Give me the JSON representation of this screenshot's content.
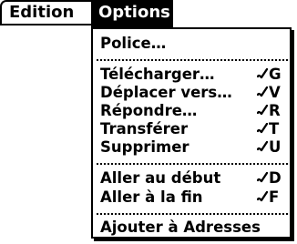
{
  "menubar": {
    "items": [
      {
        "label": "Edition",
        "selected": false
      },
      {
        "label": "Options",
        "selected": true
      }
    ]
  },
  "dropdown": {
    "items": [
      {
        "label": "Police…",
        "shortcut": ""
      },
      {
        "label": "Télécharger…",
        "shortcut": "G"
      },
      {
        "label": "Déplacer vers…",
        "shortcut": "V"
      },
      {
        "label": "Répondre…",
        "shortcut": "R"
      },
      {
        "label": "Transférer",
        "shortcut": "T"
      },
      {
        "label": "Supprimer",
        "shortcut": "U"
      },
      {
        "label": "Aller au début",
        "shortcut": "D"
      },
      {
        "label": "Aller à la fin",
        "shortcut": "F"
      },
      {
        "label": "Ajouter à Adresses",
        "shortcut": ""
      }
    ],
    "shortcut_icon": "command-stroke-icon"
  },
  "colors": {
    "foreground": "#000000",
    "background": "#ffffff",
    "selected_background": "#000000",
    "selected_text": "#ffffff"
  }
}
